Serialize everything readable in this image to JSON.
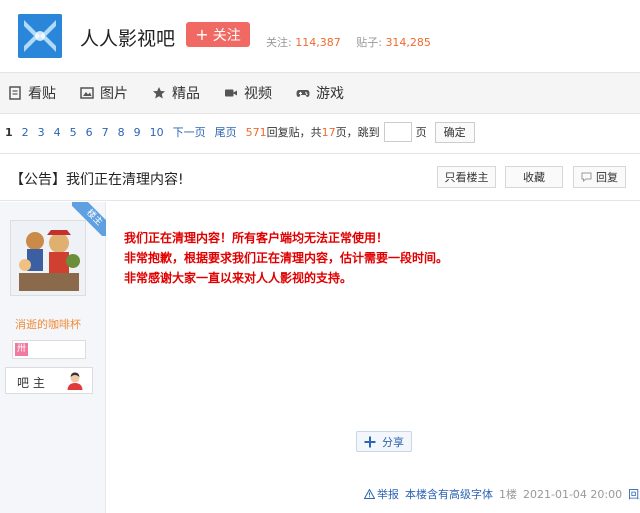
{
  "header": {
    "forum_name": "人人影视吧",
    "follow_label": "关注",
    "follow_plus": "+",
    "followers_label": "关注:",
    "followers_count": "114,387",
    "posts_label": "贴子:",
    "posts_count": "314,285"
  },
  "nav": {
    "items": [
      {
        "label": "看贴",
        "icon": "document-icon"
      },
      {
        "label": "图片",
        "icon": "image-icon"
      },
      {
        "label": "精品",
        "icon": "star-icon"
      },
      {
        "label": "视频",
        "icon": "video-camera-icon"
      },
      {
        "label": "游戏",
        "icon": "gamepad-icon"
      }
    ]
  },
  "pager": {
    "pages": [
      "1",
      "2",
      "3",
      "4",
      "5",
      "6",
      "7",
      "8",
      "9",
      "10"
    ],
    "current": "1",
    "next_label": "下一页",
    "last_label": "尾页",
    "reply_count": "571",
    "reply_text": "回复贴，共",
    "page_count": "17",
    "page_text": "页，跳到",
    "page_suffix": "页",
    "confirm_label": "确定"
  },
  "post": {
    "title": "【公告】我们正在清理内容!",
    "only_author_label": "只看楼主",
    "favorite_label": "收藏",
    "reply_label": "回复",
    "lines": [
      "我们正在清理内容！所有客户端均无法正常使用！",
      "非常抱歉，根据要求我们正在清理内容，估计需要一段时间。",
      "非常感谢大家一直以来对人人影视的支持。"
    ],
    "share_label": "分享"
  },
  "author": {
    "corner_badge": "楼主",
    "name": "消逝的咖啡杯",
    "level_icon": "卅",
    "role": "吧 主"
  },
  "tail": {
    "report_label": "举报",
    "font_note": "本楼含有高级字体",
    "floor": "1楼",
    "timestamp": "2021-01-04 20:00",
    "reply_label": "回复"
  },
  "colors": {
    "accent_red": "#f06a63",
    "link_blue": "#2d64b3",
    "content_red": "#e10000",
    "number_orange": "#f06a30"
  }
}
